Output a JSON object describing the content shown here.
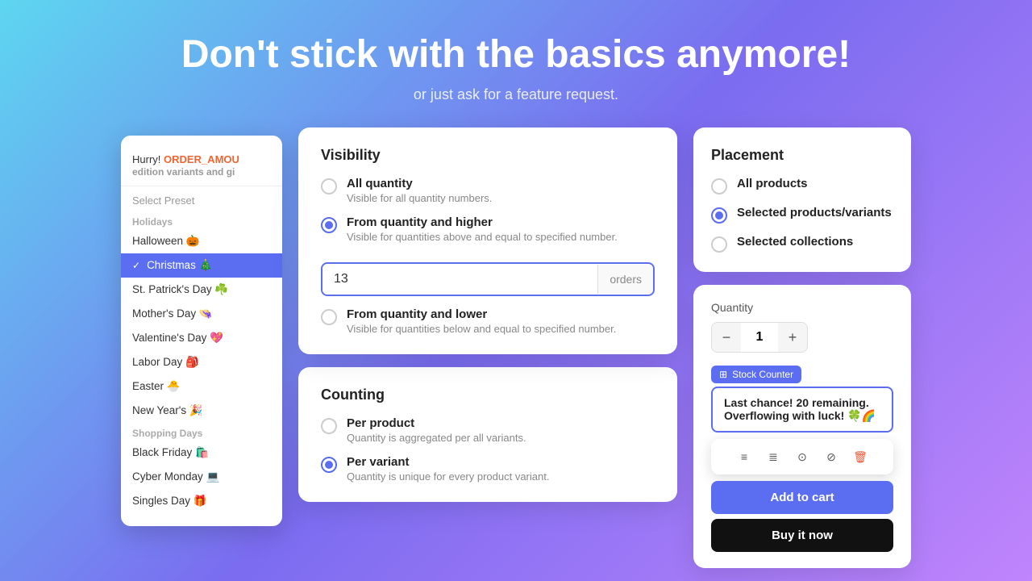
{
  "header": {
    "title": "Don't stick with the basics anymore!",
    "subtitle": "or just ask for a feature request."
  },
  "leftPanel": {
    "hurry": "Hurry! ORDER_AMOU",
    "hurry_colored": "ORDER_AMOU",
    "hurry_suffix": "edition variants and gi",
    "selectPreset": "Select Preset",
    "sections": [
      {
        "label": "Holidays",
        "items": [
          {
            "name": "Halloween 🎃",
            "active": false
          },
          {
            "name": "Christmas 🎄",
            "active": true
          },
          {
            "name": "St. Patrick's Day ☘️",
            "active": false
          },
          {
            "name": "Mother's Day 👒",
            "active": false
          },
          {
            "name": "Valentine's Day 💖",
            "active": false
          },
          {
            "name": "Labor Day 🎒",
            "active": false
          },
          {
            "name": "Easter 🐣",
            "active": false
          },
          {
            "name": "New Year's 🎉",
            "active": false
          }
        ]
      },
      {
        "label": "Shopping Days",
        "items": [
          {
            "name": "Black Friday 🛍️",
            "active": false
          },
          {
            "name": "Cyber Monday 💻",
            "active": false
          },
          {
            "name": "Singles Day 🎁",
            "active": false
          }
        ]
      }
    ]
  },
  "visibilityCard": {
    "title": "Visibility",
    "options": [
      {
        "label": "All quantity",
        "desc": "Visible for all quantity numbers.",
        "checked": false
      },
      {
        "label": "From quantity and higher",
        "desc": "Visible for quantities above and equal to specified number.",
        "checked": true
      },
      {
        "label": "From quantity and lower",
        "desc": "Visible for quantities below and equal to specified number.",
        "checked": false
      }
    ],
    "inputValue": "13",
    "inputUnit": "orders"
  },
  "placementCard": {
    "title": "Placement",
    "options": [
      {
        "label": "All products",
        "checked": false
      },
      {
        "label": "Selected products/variants",
        "checked": true
      },
      {
        "label": "Selected collections",
        "checked": false
      }
    ]
  },
  "qtyWidget": {
    "label": "Quantity",
    "value": "1",
    "decrementLabel": "−",
    "incrementLabel": "+",
    "badgeLabel": "Stock Counter",
    "stockMessage1": "Last chance! 20 remaining.",
    "stockMessage2": "Overflowing with luck! 🍀🌈",
    "addToCartLabel": "Add to cart",
    "buyNowLabel": "Buy it now"
  },
  "countingCard": {
    "title": "Counting",
    "options": [
      {
        "label": "Per product",
        "desc": "Quantity is aggregated per all variants.",
        "checked": false
      },
      {
        "label": "Per variant",
        "desc": "Quantity is unique for every product variant.",
        "checked": true
      }
    ]
  },
  "toolbar": {
    "buttons": [
      "≡",
      "≣",
      "⊙",
      "⊘",
      "🗑"
    ]
  }
}
